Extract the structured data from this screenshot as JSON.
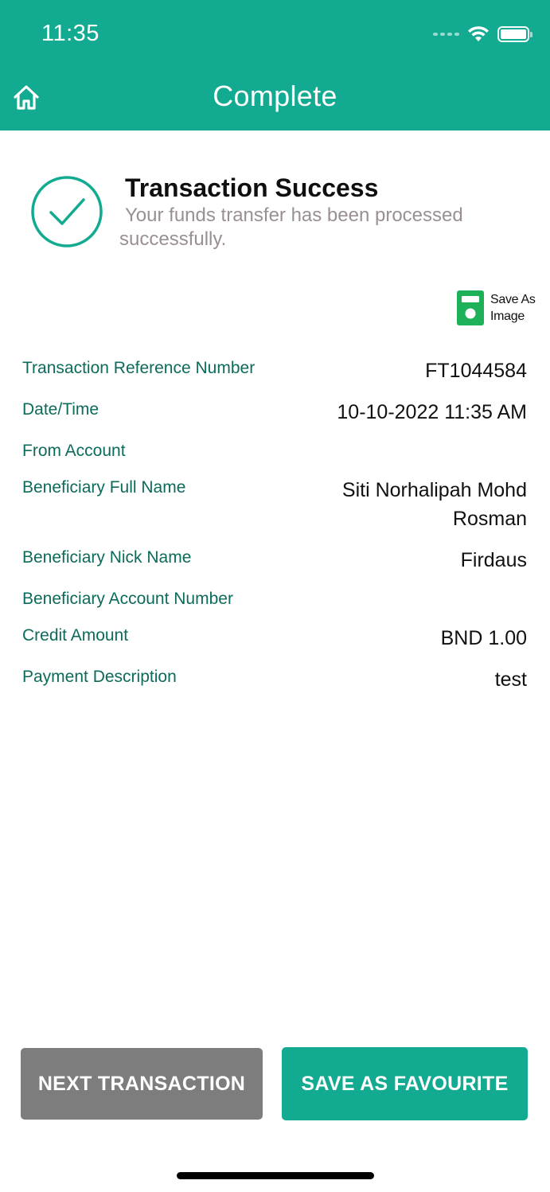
{
  "status_bar": {
    "time": "11:35"
  },
  "nav": {
    "title": "Complete",
    "home_icon": "home-icon"
  },
  "result": {
    "title": "Transaction Success",
    "message": "Your funds transfer has been processed successfully."
  },
  "save_image": {
    "label": "Save As\nImage",
    "icon": "sd-card-icon"
  },
  "details": [
    {
      "label": "Transaction Reference Number",
      "value": "FT1044584"
    },
    {
      "label": "Date/Time",
      "value": "10-10-2022 11:35 AM"
    },
    {
      "label": "From Account",
      "value": ""
    },
    {
      "label": "Beneficiary Full Name",
      "value": "Siti Norhalipah Mohd Rosman"
    },
    {
      "label": "Beneficiary Nick Name",
      "value": "Firdaus"
    },
    {
      "label": "Beneficiary Account Number",
      "value": ""
    },
    {
      "label": "Credit Amount",
      "value": "BND 1.00"
    },
    {
      "label": "Payment Description",
      "value": "test"
    }
  ],
  "buttons": {
    "next_transaction": "NEXT TRANSACTION",
    "save_favourite": "SAVE AS FAVOURITE"
  },
  "colors": {
    "brand": "#12ab91",
    "label_text": "#0c6b5a",
    "secondary_button": "#7d7d7d"
  }
}
